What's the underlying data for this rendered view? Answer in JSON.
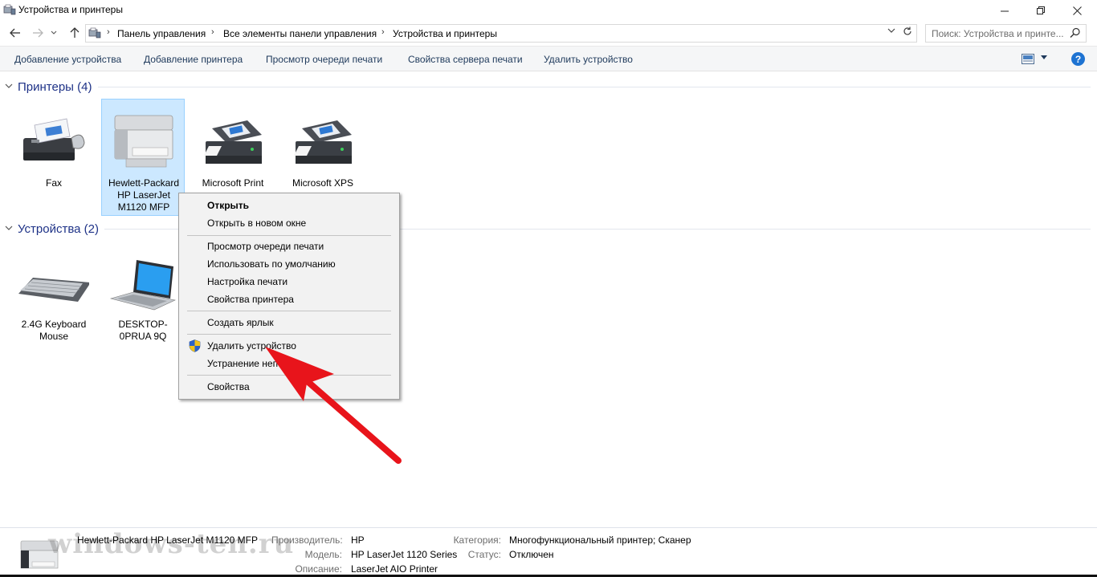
{
  "window": {
    "title": "Устройства и принтеры",
    "minimize_icon": "minimize-icon",
    "maximize_icon": "restore-icon",
    "close_icon": "close-icon"
  },
  "nav": {
    "breadcrumbs": [
      "Панель управления",
      "Все элементы панели управления",
      "Устройства и принтеры"
    ],
    "search_placeholder": "Поиск: Устройства и принте..."
  },
  "commands": {
    "add_device": "Добавление устройства",
    "add_printer": "Добавление принтера",
    "print_queue": "Просмотр очереди печати",
    "server_props": "Свойства сервера печати",
    "remove_device": "Удалить устройство",
    "help": "?"
  },
  "groups": {
    "printers": {
      "label": "Принтеры (4)",
      "items": [
        {
          "label": "Fax",
          "icon": "fax-icon"
        },
        {
          "label": "Hewlett-Packard HP LaserJet M1120 MFP",
          "icon": "mfp-printer-icon",
          "selected": true
        },
        {
          "label": "Microsoft Print",
          "icon": "printer-icon"
        },
        {
          "label": "Microsoft XPS",
          "icon": "printer-icon"
        }
      ]
    },
    "devices": {
      "label": "Устройства (2)",
      "items": [
        {
          "label": "2.4G Keyboard Mouse",
          "icon": "keyboard-icon"
        },
        {
          "label": "DESKTOP-0PRUA 9Q",
          "icon": "laptop-icon"
        }
      ]
    }
  },
  "context_menu": {
    "open": "Открыть",
    "open_new_window": "Открыть в новом окне",
    "view_queue": "Просмотр очереди печати",
    "set_default": "Использовать по умолчанию",
    "print_prefs": "Настройка печати",
    "printer_props": "Свойства принтера",
    "create_shortcut": "Создать ярлык",
    "remove_device": "Удалить устройство",
    "troubleshoot": "Устранение непола",
    "properties": "Свойства"
  },
  "details": {
    "name": "Hewlett-Packard HP LaserJet M1120 MFP",
    "manufacturer_key": "Производитель:",
    "manufacturer_val": "HP",
    "model_key": "Модель:",
    "model_val": "HP LaserJet 1120 Series",
    "description_key": "Описание:",
    "description_val": "LaserJet AIO Printer",
    "category_key": "Категория:",
    "category_val": "Многофункциональный принтер; Сканер",
    "status_key": "Статус:",
    "status_val": "Отключен"
  },
  "watermark": "windows-ten.ru",
  "colors": {
    "accent": "#1e3287",
    "selection": "#cce8ff",
    "arrow": "#e8141b"
  }
}
